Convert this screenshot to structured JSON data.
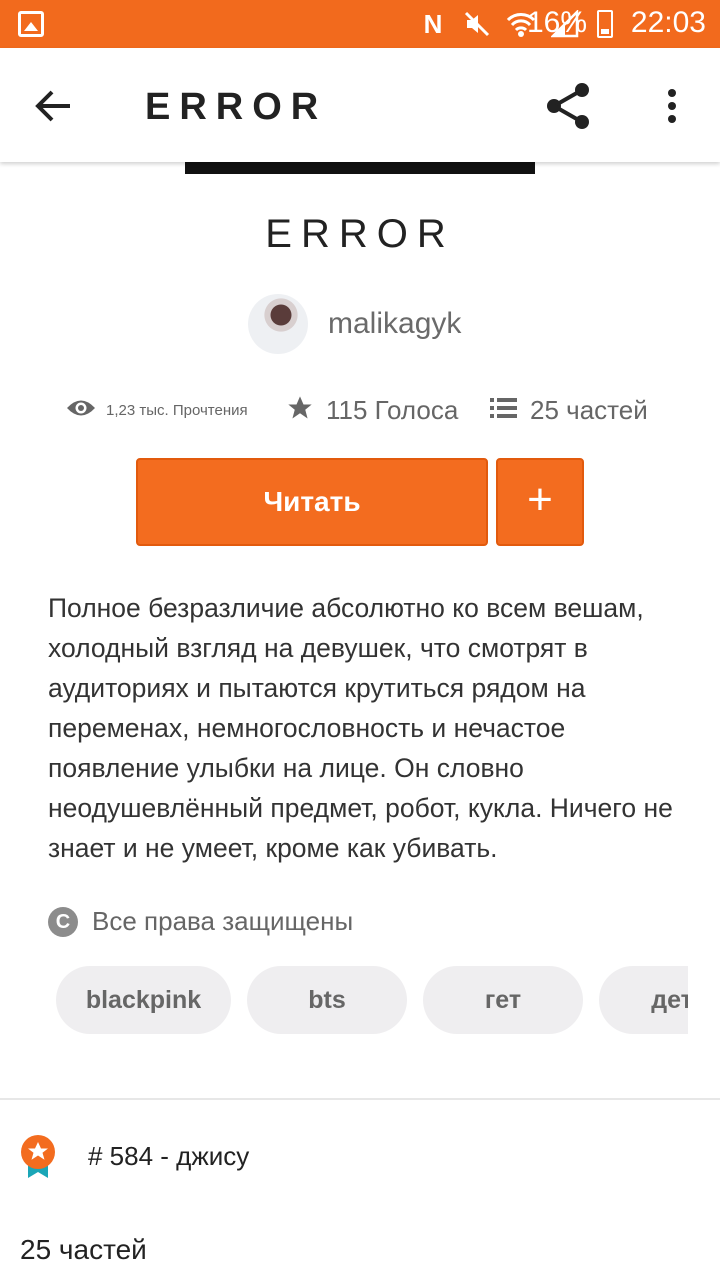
{
  "status_bar": {
    "battery_percent": "16%",
    "time": "22:03",
    "icons": [
      "gallery-icon",
      "nfc-icon",
      "mute-icon",
      "wifi-icon",
      "signal-icon",
      "battery-charging-icon"
    ]
  },
  "app_bar": {
    "title": "ERROR",
    "back_icon": "back-arrow-icon",
    "share_icon": "share-icon",
    "more_icon": "more-vert-icon"
  },
  "story": {
    "title": "ERROR",
    "author": "malikagyk",
    "reads": "1,23 тыс. Прочтения",
    "votes": "115 Голоса",
    "parts": "25 частей",
    "read_button": "Читать",
    "add_button": "+",
    "description": "Полное безразличие абсолютно ко всем вешам, холодный взгляд на девушек, что смотрят в аудиториях и пытаются крутиться рядом на переменах, немногословность и нечастое появление улыбки на лице. Он словно неодушевлённый предмет, робот, кукла. Ничего не знает и не умеет, кроме как убивать.",
    "copyright": "Все права защищены",
    "tags": [
      "blackpink",
      "bts",
      "гет",
      "дете"
    ],
    "rank": "# 584 - джису",
    "parts_count": "25 частей"
  },
  "colors": {
    "accent": "#f36c1f",
    "status_bar": "#f26a1d",
    "tag_bg": "#efeef0",
    "badge_blue": "#1aa6b7"
  }
}
